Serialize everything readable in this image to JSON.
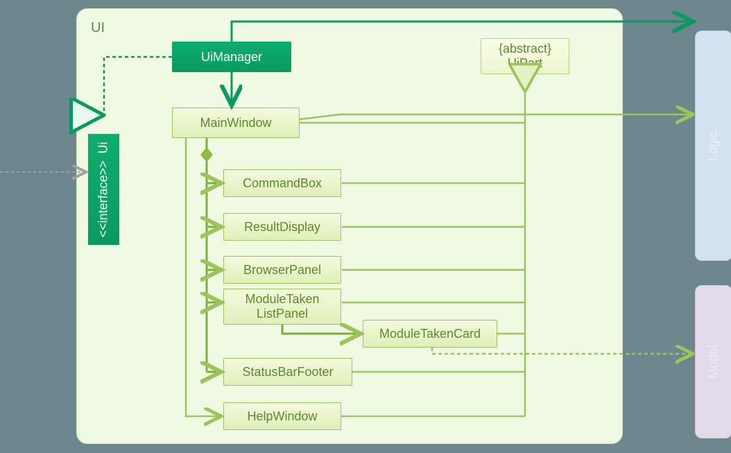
{
  "package": {
    "name": "UI"
  },
  "interface": {
    "stereotype": "<<interface>>",
    "name": "Ui"
  },
  "nodes": {
    "uiManager": "UiManager",
    "mainWindow": "MainWindow",
    "uiPart": {
      "stereotype": "{abstract}",
      "name": "UiPart"
    },
    "commandBox": "CommandBox",
    "resultDisplay": "ResultDisplay",
    "browserPanel": "BrowserPanel",
    "moduleTakenListPanel_l1": "ModuleTaken",
    "moduleTakenListPanel_l2": "ListPanel",
    "moduleTakenCard": "ModuleTakenCard",
    "statusBarFooter": "StatusBarFooter",
    "helpWindow": "HelpWindow"
  },
  "external": {
    "logic": "Logic",
    "model": "Model"
  },
  "colors": {
    "darkGreen": "#0a9a60",
    "olive": "#9bc559",
    "oliveDark": "#6f9a34",
    "gray": "#a0a0a0"
  }
}
